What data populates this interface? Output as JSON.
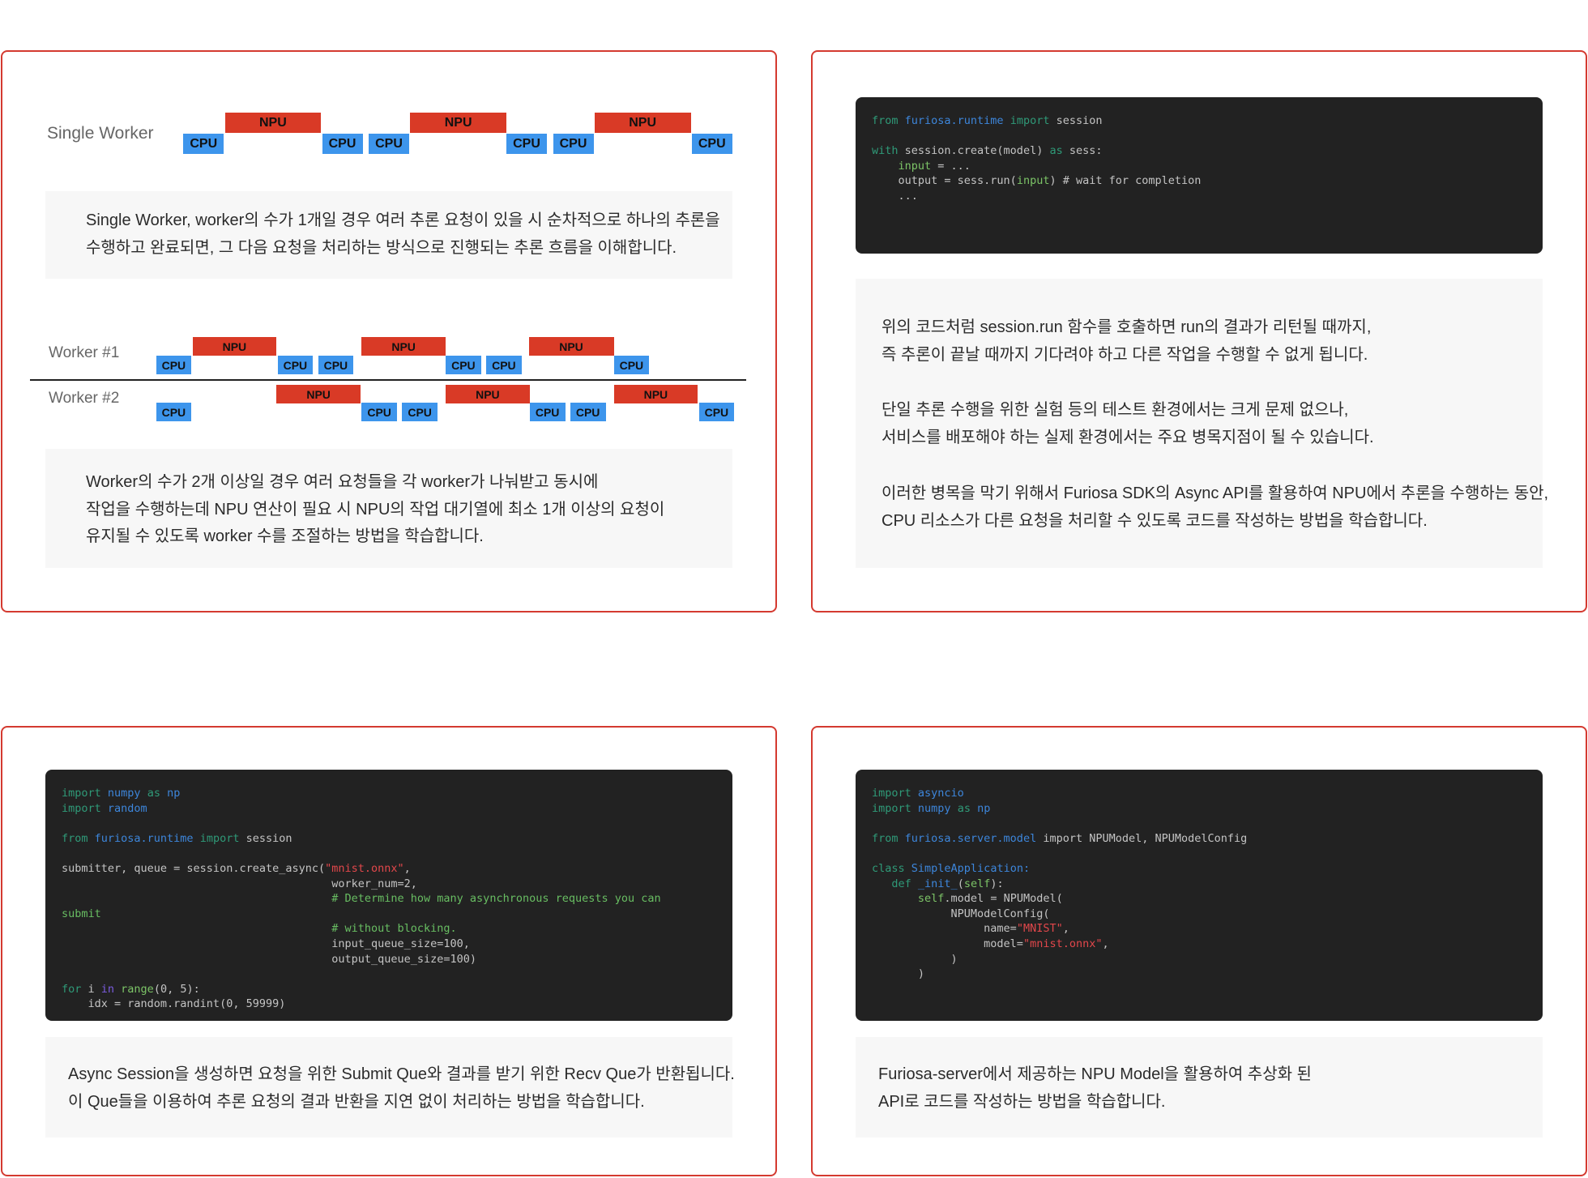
{
  "colors": {
    "card_border": "#d43a30",
    "cpu": "#3d95ec",
    "npu": "#d93a26",
    "code_bg": "#222222",
    "panel_bg": "#f7f7f7"
  },
  "single_worker": {
    "label": "Single Worker",
    "blocks": [
      "CPU",
      "NPU",
      "CPU",
      "CPU",
      "NPU",
      "CPU",
      "CPU",
      "NPU",
      "CPU"
    ],
    "description": [
      "Single Worker, worker의 수가 1개일 경우 여러 추론 요청이 있을 시 순차적으로 하나의 추론을",
      "수행하고 완료되면, 그 다음 요청을 처리하는 방식으로 진행되는 추론 흐름을 이해합니다."
    ]
  },
  "multi_worker": {
    "worker1_label": "Worker #1",
    "worker2_label": "Worker #2",
    "worker1_blocks": [
      "CPU",
      "NPU",
      "CPU",
      "CPU",
      "NPU",
      "CPU",
      "CPU",
      "NPU",
      "CPU"
    ],
    "worker2_blocks": [
      "CPU",
      "NPU",
      "CPU",
      "CPU",
      "NPU",
      "CPU",
      "CPU",
      "NPU",
      "CPU"
    ],
    "description": [
      "Worker의 수가 2개 이상일 경우 여러 요청들을 각 worker가 나눠받고 동시에",
      "작업을 수행하는데 NPU 연산이 필요 시 NPU의 작업 대기열에 최소 1개 이상의 요청이",
      "유지될 수 있도록 worker 수를 조절하는 방법을 학습합니다."
    ]
  },
  "sync_code": {
    "lines": [
      [
        [
          "from ",
          "k"
        ],
        [
          "furiosa.runtime ",
          "m"
        ],
        [
          "import ",
          "k"
        ],
        [
          "session",
          "d"
        ]
      ],
      [],
      [
        [
          "with ",
          "k"
        ],
        [
          "session.create(model) ",
          "d"
        ],
        [
          "as ",
          "k"
        ],
        [
          "sess:",
          "d"
        ]
      ],
      [
        [
          "    ",
          "d"
        ],
        [
          "input",
          "g"
        ],
        [
          " = ...",
          "d"
        ]
      ],
      [
        [
          "    output = sess.run(",
          "d"
        ],
        [
          "input",
          "g"
        ],
        [
          ") # wait for completion",
          "d"
        ]
      ],
      [
        [
          "    ...",
          "d"
        ]
      ]
    ],
    "description": [
      "위의 코드처럼 session.run 함수를 호출하면 run의 결과가 리턴될 때까지,",
      "즉 추론이 끝날 때까지 기다려야 하고 다른 작업을 수행할 수 없게 됩니다.",
      "단일 추론 수행을 위한 실험 등의 테스트 환경에서는 크게 문제 없으나,",
      "서비스를 배포해야 하는 실제 환경에서는 주요 병목지점이 될 수 있습니다.",
      "이러한 병목을 막기 위해서 Furiosa SDK의 Async API를 활용하여 NPU에서 추론을 수행하는 동안,",
      "CPU 리소스가 다른 요청을 처리할 수 있도록 코드를 작성하는 방법을 학습합니다."
    ]
  },
  "async_code": {
    "lines": [
      [
        [
          "import ",
          "k"
        ],
        [
          "numpy ",
          "m"
        ],
        [
          "as ",
          "k"
        ],
        [
          "np",
          "m"
        ]
      ],
      [
        [
          "import ",
          "k"
        ],
        [
          "random",
          "m"
        ]
      ],
      [],
      [
        [
          "from ",
          "k"
        ],
        [
          "furiosa.runtime ",
          "m"
        ],
        [
          "import ",
          "k"
        ],
        [
          "session",
          "d"
        ]
      ],
      [],
      [
        [
          "submitter, queue = session.create_async(",
          "d"
        ],
        [
          "\"mnist.onnx\"",
          "s"
        ],
        [
          ",",
          "d"
        ]
      ],
      [
        [
          "                                         worker_num=2,",
          "d"
        ]
      ],
      [
        [
          "                                         ",
          "d"
        ],
        [
          "# Determine how many asynchronous requests you can",
          "c"
        ]
      ],
      [
        [
          "submit",
          "c"
        ]
      ],
      [
        [
          "                                         ",
          "d"
        ],
        [
          "# without blocking.",
          "c"
        ]
      ],
      [
        [
          "                                         input_queue_size=100,",
          "d"
        ]
      ],
      [
        [
          "                                         output_queue_size=100)",
          "d"
        ]
      ],
      [],
      [
        [
          "for ",
          "k"
        ],
        [
          "i ",
          "d"
        ],
        [
          "in ",
          "p"
        ],
        [
          "range",
          "g"
        ],
        [
          "(0, 5):",
          "d"
        ]
      ],
      [
        [
          "    idx = random.randint(0, 59999)",
          "d"
        ]
      ]
    ],
    "description": [
      "Async Session을 생성하면 요청을 위한 Submit Que와 결과를 받기 위한 Recv Que가 반환됩니다.",
      "이 Que들을 이용하여 추론 요청의 결과 반환을 지연 없이 처리하는 방법을 학습합니다."
    ]
  },
  "server_code": {
    "lines": [
      [
        [
          "import ",
          "k"
        ],
        [
          "asyncio",
          "m"
        ]
      ],
      [
        [
          "import ",
          "k"
        ],
        [
          "numpy ",
          "m"
        ],
        [
          "as ",
          "k"
        ],
        [
          "np",
          "m"
        ]
      ],
      [],
      [
        [
          "from ",
          "k"
        ],
        [
          "furiosa.server.model ",
          "m"
        ],
        [
          "import NPUModel, NPUModelConfig",
          "d"
        ]
      ],
      [],
      [
        [
          "class ",
          "k"
        ],
        [
          "SimpleApplication:",
          "m"
        ]
      ],
      [
        [
          "   ",
          "d"
        ],
        [
          "def ",
          "k"
        ],
        [
          "_init_",
          "m"
        ],
        [
          "(",
          "d"
        ],
        [
          "self",
          "g"
        ],
        [
          "):",
          "d"
        ]
      ],
      [
        [
          "       ",
          "d"
        ],
        [
          "self",
          "g"
        ],
        [
          ".model = NPUModel(",
          "d"
        ]
      ],
      [
        [
          "            NPUModelConfig(",
          "d"
        ]
      ],
      [
        [
          "                 name=",
          "d"
        ],
        [
          "\"MNIST\"",
          "s"
        ],
        [
          ",",
          "d"
        ]
      ],
      [
        [
          "                 model=",
          "d"
        ],
        [
          "\"mnist.onnx\"",
          "s"
        ],
        [
          ",",
          "d"
        ]
      ],
      [
        [
          "            )",
          "d"
        ]
      ],
      [
        [
          "       )",
          "d"
        ]
      ]
    ],
    "description": [
      "Furiosa-server에서 제공하는 NPU Model을 활용하여 추상화 된",
      "API로 코드를 작성하는 방법을 학습합니다."
    ]
  }
}
